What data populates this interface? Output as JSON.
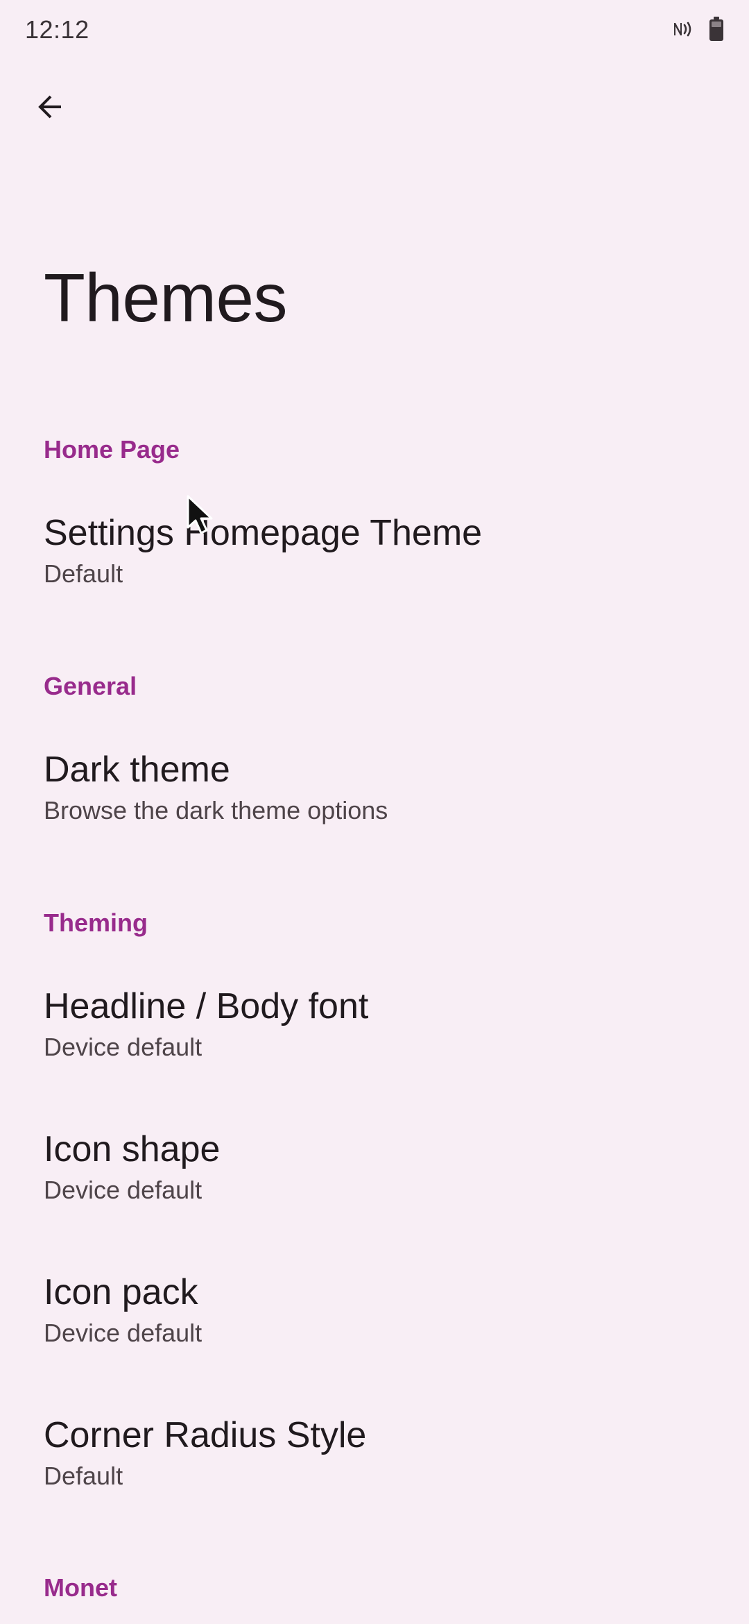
{
  "status_bar": {
    "time": "12:12",
    "icons": [
      "nfc-icon",
      "battery-icon"
    ]
  },
  "toolbar": {
    "back_icon": "arrow-left-icon"
  },
  "page": {
    "title": "Themes"
  },
  "sections": [
    {
      "category": "Home Page",
      "items": [
        {
          "title": "Settings Homepage Theme",
          "summary": "Default"
        }
      ]
    },
    {
      "category": "General",
      "items": [
        {
          "title": "Dark theme",
          "summary": "Browse the dark theme options"
        }
      ]
    },
    {
      "category": "Theming",
      "items": [
        {
          "title": "Headline / Body font",
          "summary": "Device default"
        },
        {
          "title": "Icon shape",
          "summary": "Device default"
        },
        {
          "title": "Icon pack",
          "summary": "Device default"
        },
        {
          "title": "Corner Radius Style",
          "summary": "Default"
        }
      ]
    },
    {
      "category": "Monet",
      "items": []
    }
  ],
  "colors": {
    "background": "#f8eef5",
    "accent": "#982b8c",
    "text_primary": "#201a1e",
    "text_secondary": "#4e4449"
  }
}
